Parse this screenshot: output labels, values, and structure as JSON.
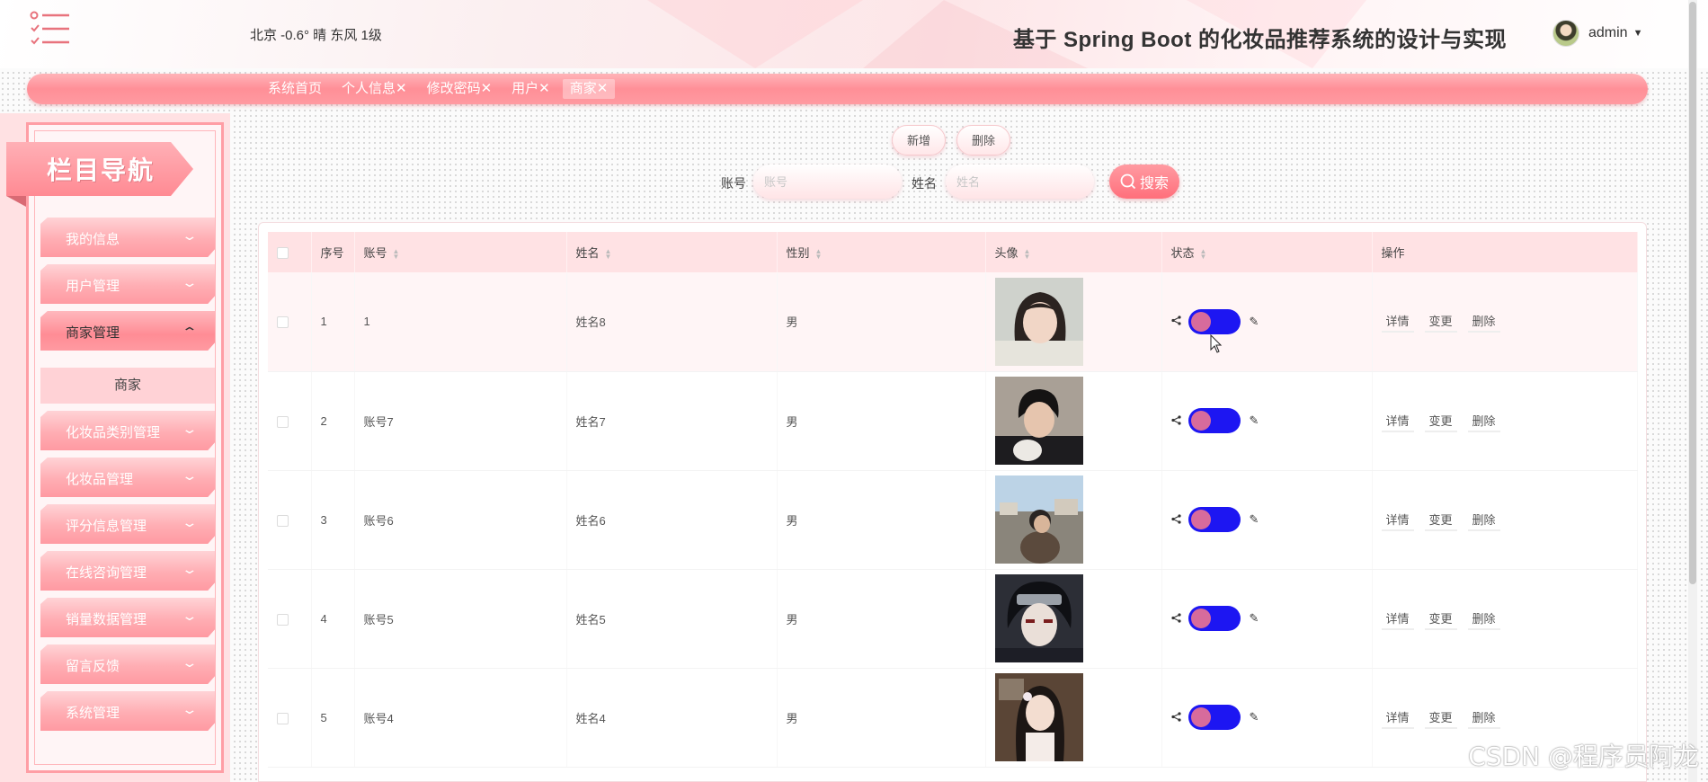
{
  "header": {
    "weather": "北京  -0.6°  晴  东风  1级",
    "title": "基于 Spring Boot 的化妆品推荐系统的设计与实现",
    "user": "admin"
  },
  "tabs": [
    "系统首页",
    "个人信息✕",
    "修改密码✕",
    "用户✕",
    "商家✕"
  ],
  "sidebar": {
    "heading": "栏目导航",
    "items": [
      {
        "label": "我的信息"
      },
      {
        "label": "用户管理"
      },
      {
        "label": "商家管理"
      },
      {
        "label": "化妆品类别管理"
      },
      {
        "label": "化妆品管理"
      },
      {
        "label": "评分信息管理"
      },
      {
        "label": "在线咨询管理"
      },
      {
        "label": "销量数据管理"
      },
      {
        "label": "留言反馈"
      },
      {
        "label": "系统管理"
      }
    ],
    "sub_item": "商家"
  },
  "toolbar": {
    "add": "新增",
    "delete": "删除"
  },
  "search": {
    "account_label": "账号",
    "account_placeholder": "账号",
    "name_label": "姓名",
    "name_placeholder": "姓名",
    "button": "搜索"
  },
  "table": {
    "columns": [
      "序号",
      "账号",
      "姓名",
      "性别",
      "头像",
      "状态",
      "操作"
    ],
    "rows": [
      {
        "no": "1",
        "account": "1",
        "name": "姓名8",
        "gender": "男"
      },
      {
        "no": "2",
        "account": "账号7",
        "name": "姓名7",
        "gender": "男"
      },
      {
        "no": "3",
        "account": "账号6",
        "name": "姓名6",
        "gender": "男"
      },
      {
        "no": "4",
        "account": "账号5",
        "name": "姓名5",
        "gender": "男"
      },
      {
        "no": "5",
        "account": "账号4",
        "name": "姓名4",
        "gender": "男"
      }
    ],
    "actions": [
      "详情",
      "变更",
      "删除"
    ]
  },
  "watermark": "CSDN @程序员阿龙"
}
